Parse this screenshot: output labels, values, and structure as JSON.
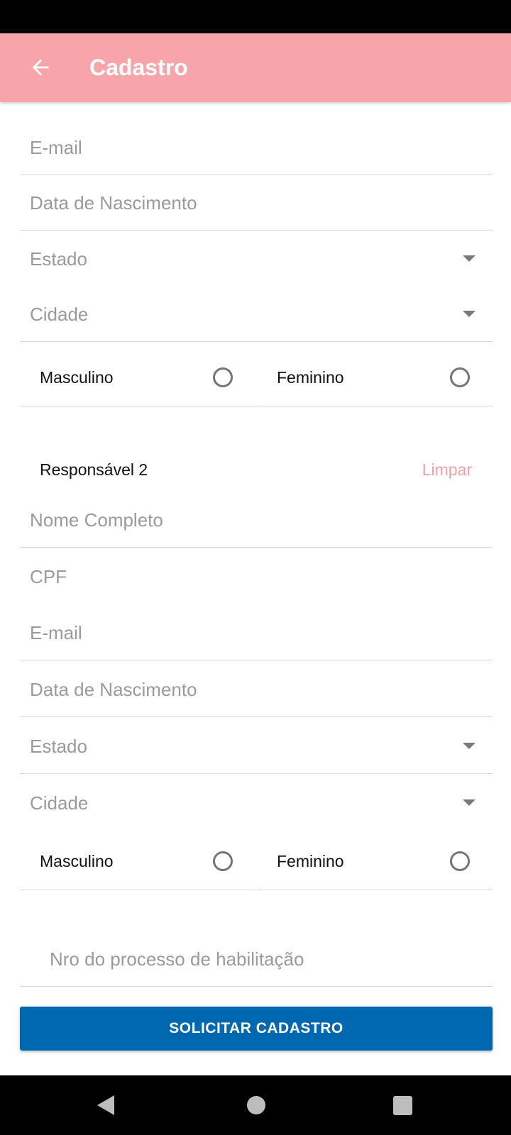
{
  "app_bar": {
    "title": "Cadastro",
    "back_icon": "arrow-left-icon",
    "background": "#f7a5aa"
  },
  "form1": {
    "email_placeholder": "E-mail",
    "birthdate_placeholder": "Data de Nascimento",
    "state_placeholder": "Estado",
    "city_placeholder": "Cidade",
    "gender_male": "Masculino",
    "gender_female": "Feminino"
  },
  "responsavel2": {
    "title": "Responsável 2",
    "clear_label": "Limpar",
    "name_placeholder": "Nome Completo",
    "cpf_placeholder": "CPF",
    "email_placeholder": "E-mail",
    "birthdate_placeholder": "Data de Nascimento",
    "state_placeholder": "Estado",
    "city_placeholder": "Cidade",
    "gender_male": "Masculino",
    "gender_female": "Feminino"
  },
  "process": {
    "placeholder": "Nro do processo de habilitação"
  },
  "submit": {
    "label": "SOLICITAR CADASTRO",
    "color": "#0068b0"
  },
  "colors": {
    "accent_pink": "#f3a0a5",
    "placeholder_gray": "#9a9a9a"
  }
}
